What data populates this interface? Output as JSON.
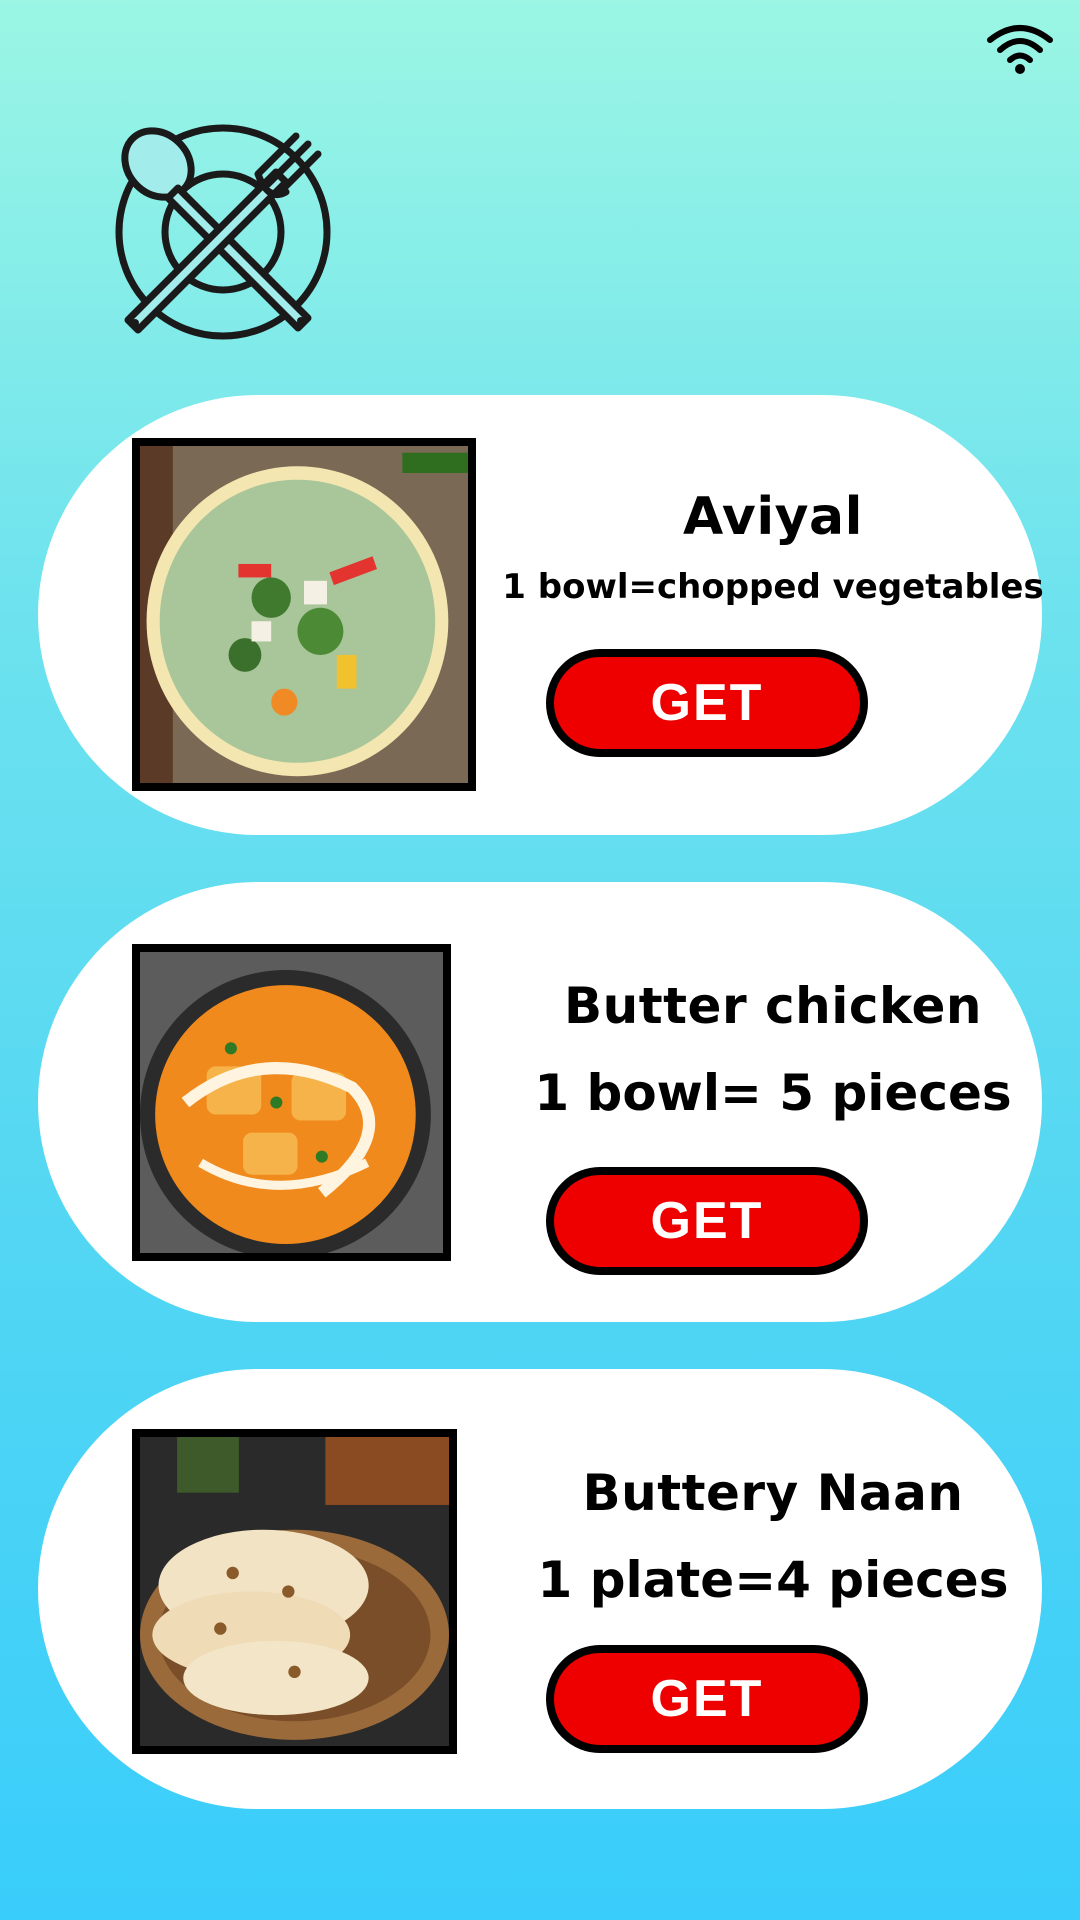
{
  "icons": {
    "status": "wifi-icon",
    "logo": "plate-fork-spoon-icon"
  },
  "colors": {
    "button": "#ee0000",
    "card": "#ffffff",
    "background_top": "#9bf6e4",
    "background_bottom": "#39cdfb"
  },
  "menu": [
    {
      "name": "Aviyal",
      "portion": "1 bowl=chopped vegetables",
      "button_label": "GET"
    },
    {
      "name": "Butter chicken",
      "portion": "1 bowl= 5 pieces",
      "button_label": "GET"
    },
    {
      "name": "Buttery Naan",
      "portion": "1 plate=4 pieces",
      "button_label": "GET"
    }
  ]
}
